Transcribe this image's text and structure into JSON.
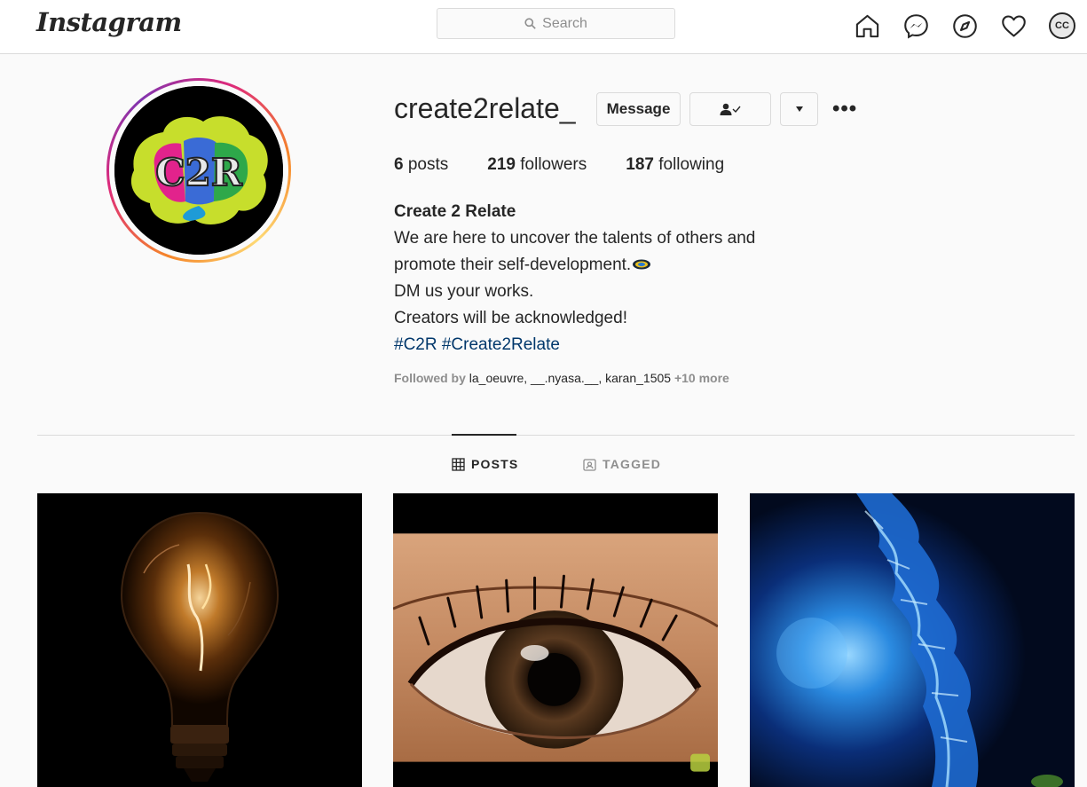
{
  "nav": {
    "logo": "Instagram",
    "search_placeholder": "Search",
    "icons": [
      "home-icon",
      "messenger-icon",
      "explore-icon",
      "activity-heart-icon",
      "profile-avatar"
    ],
    "avatar_text": "CC"
  },
  "profile": {
    "username": "create2relate_",
    "message_label": "Message",
    "stats": {
      "posts_count": "6",
      "posts_label": "posts",
      "followers_count": "219",
      "followers_label": "followers",
      "following_count": "187",
      "following_label": "following"
    },
    "bio": {
      "name": "Create 2 Relate",
      "lines": [
        "We are here to uncover the talents of others and",
        "promote their self-development.",
        "DM us your works.",
        "Creators will be acknowledged!"
      ],
      "hashtags": [
        "#C2R",
        "#Create2Relate"
      ]
    },
    "followed_by": {
      "prefix": "Followed by",
      "names": "la_oeuvre, __.nyasa.__, karan_1505",
      "more": "+10 more"
    },
    "avatar_text": "C2R"
  },
  "tabs": [
    {
      "label": "POSTS",
      "active": true
    },
    {
      "label": "TAGGED",
      "active": false
    }
  ],
  "posts": [
    {
      "subject": "light bulb"
    },
    {
      "subject": "eye close-up"
    },
    {
      "subject": "blue ice"
    }
  ],
  "colors": {
    "hashtag": "#00376b",
    "muted": "#8e8e8e",
    "border": "#dbdbdb"
  }
}
